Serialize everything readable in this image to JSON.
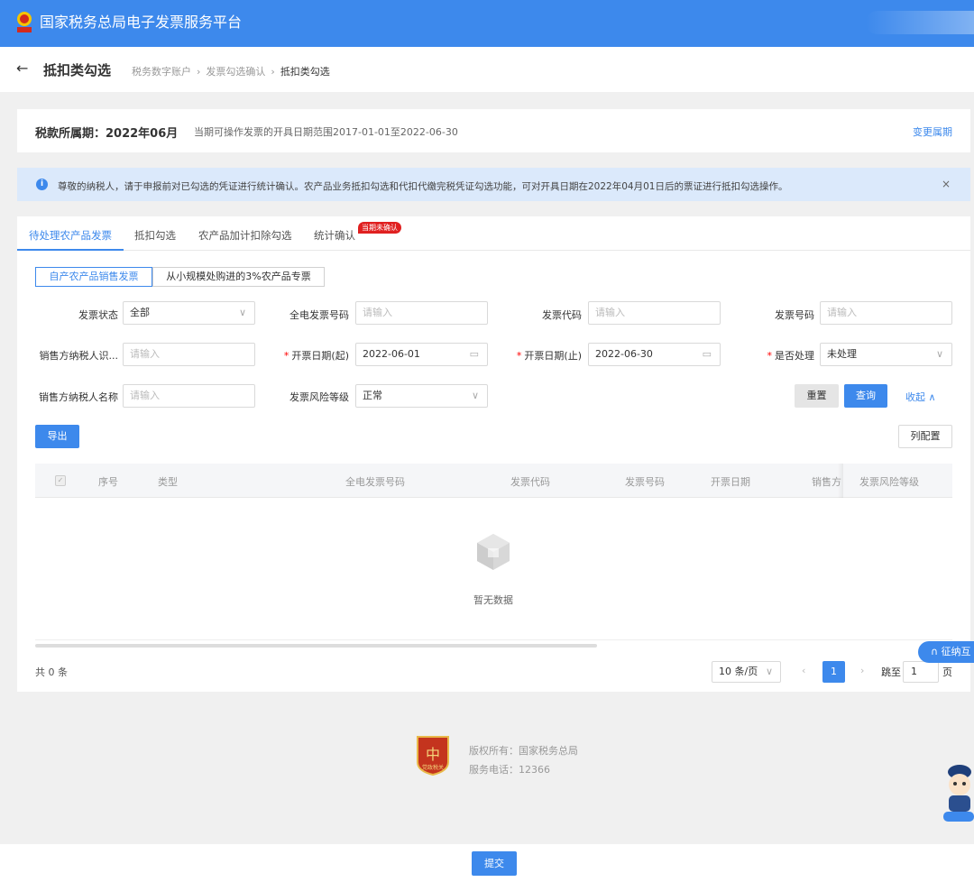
{
  "header": {
    "site_title": "国家税务总局电子发票服务平台",
    "emblem_caption": "国家税务"
  },
  "subheader": {
    "back": "←",
    "page_title": "抵扣类勾选",
    "breadcrumbs": [
      "税务数字账户",
      "发票勾选确认",
      "抵扣类勾选"
    ],
    "sep": "›"
  },
  "period": {
    "label": "税款所属期：2022年06月",
    "desc": "当期可操作发票的开具日期范围2017-01-01至2022-06-30",
    "change_link": "变更属期"
  },
  "notice": {
    "icon": "i",
    "text": "尊敬的纳税人，请于申报前对已勾选的凭证进行统计确认。农产品业务抵扣勾选和代扣代缴完税凭证勾选功能，可对开具日期在2022年04月01日后的票证进行抵扣勾选操作。",
    "close": "×"
  },
  "tabs": [
    "待处理农产品发票",
    "抵扣勾选",
    "农产品加计扣除勾选",
    "统计确认"
  ],
  "tab_badge": "当期未确认",
  "segments": [
    "自产农产品销售发票",
    "从小规模处购进的3%农产品专票"
  ],
  "filters": {
    "invoice_status": {
      "label": "发票状态",
      "value": "全部"
    },
    "full_invoice_no": {
      "label": "全电发票号码",
      "placeholder": "请输入"
    },
    "invoice_code": {
      "label": "发票代码",
      "placeholder": "请输入"
    },
    "invoice_no": {
      "label": "发票号码",
      "placeholder": "请输入"
    },
    "seller_tax_id": {
      "label": "销售方纳税人识...",
      "placeholder": "请输入"
    },
    "date_start": {
      "label": "开票日期(起)",
      "value": "2022-06-01"
    },
    "date_end": {
      "label": "开票日期(止)",
      "value": "2022-06-30"
    },
    "processed": {
      "label": "是否处理",
      "value": "未处理"
    },
    "seller_name": {
      "label": "销售方纳税人名称",
      "placeholder": "请输入"
    },
    "risk_level": {
      "label": "发票风险等级",
      "value": "正常"
    }
  },
  "buttons": {
    "reset": "重置",
    "query": "查询",
    "collapse": "收起 ∧",
    "export": "导出",
    "columns": "列配置",
    "submit": "提交"
  },
  "table": {
    "columns": [
      "序号",
      "类型",
      "全电发票号码",
      "发票代码",
      "发票号码",
      "开票日期",
      "销售方",
      "发票风险等级"
    ],
    "empty_text": "暂无数据"
  },
  "pagination": {
    "total": "共 0 条",
    "page_size": "10 条/页",
    "prev": "‹",
    "current": "1",
    "next": "›",
    "jump_label": "跳至",
    "jump_value": "1",
    "page_unit": "页"
  },
  "helper": {
    "label": "征纳互"
  },
  "footer": {
    "copyright": "版权所有：国家税务总局",
    "phone": "服务电话：12366",
    "logo_caption": "党政税关"
  },
  "colors": {
    "primary": "#3d89ec",
    "badge": "#e02020",
    "notice_bg": "#dbe9fb"
  }
}
